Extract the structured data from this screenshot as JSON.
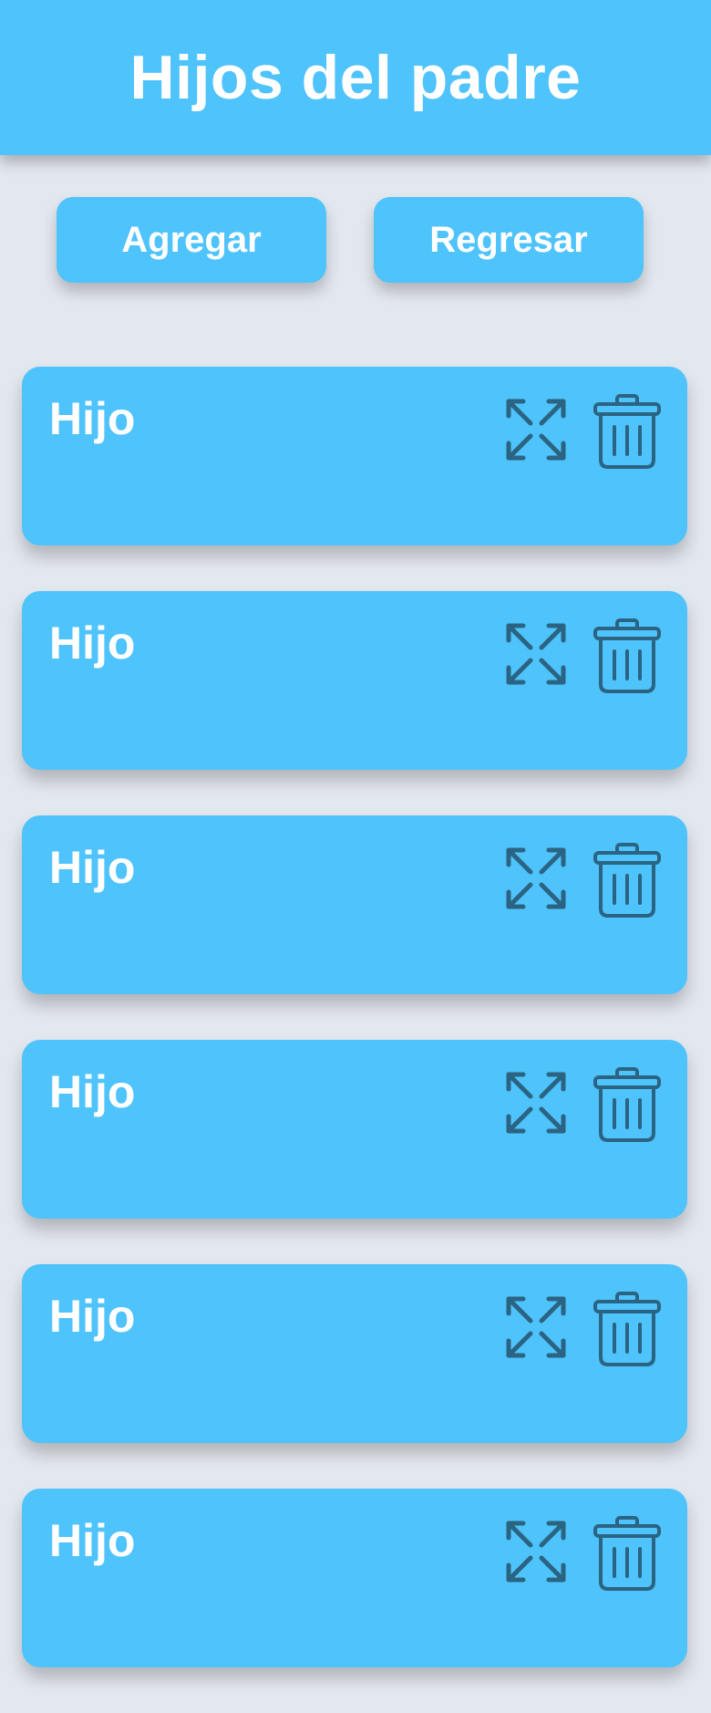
{
  "header": {
    "title": "Hijos del padre"
  },
  "actions": {
    "add_label": "Agregar",
    "back_label": "Regresar"
  },
  "children": [
    {
      "label": "Hijo"
    },
    {
      "label": "Hijo"
    },
    {
      "label": "Hijo"
    },
    {
      "label": "Hijo"
    },
    {
      "label": "Hijo"
    },
    {
      "label": "Hijo"
    }
  ],
  "icons": {
    "expand": "expand-arrows-icon",
    "delete": "trash-icon"
  },
  "colors": {
    "accent": "#4fc3fb",
    "background": "#e3e8ef",
    "icon": "#2b6483",
    "text": "#ffffff"
  }
}
